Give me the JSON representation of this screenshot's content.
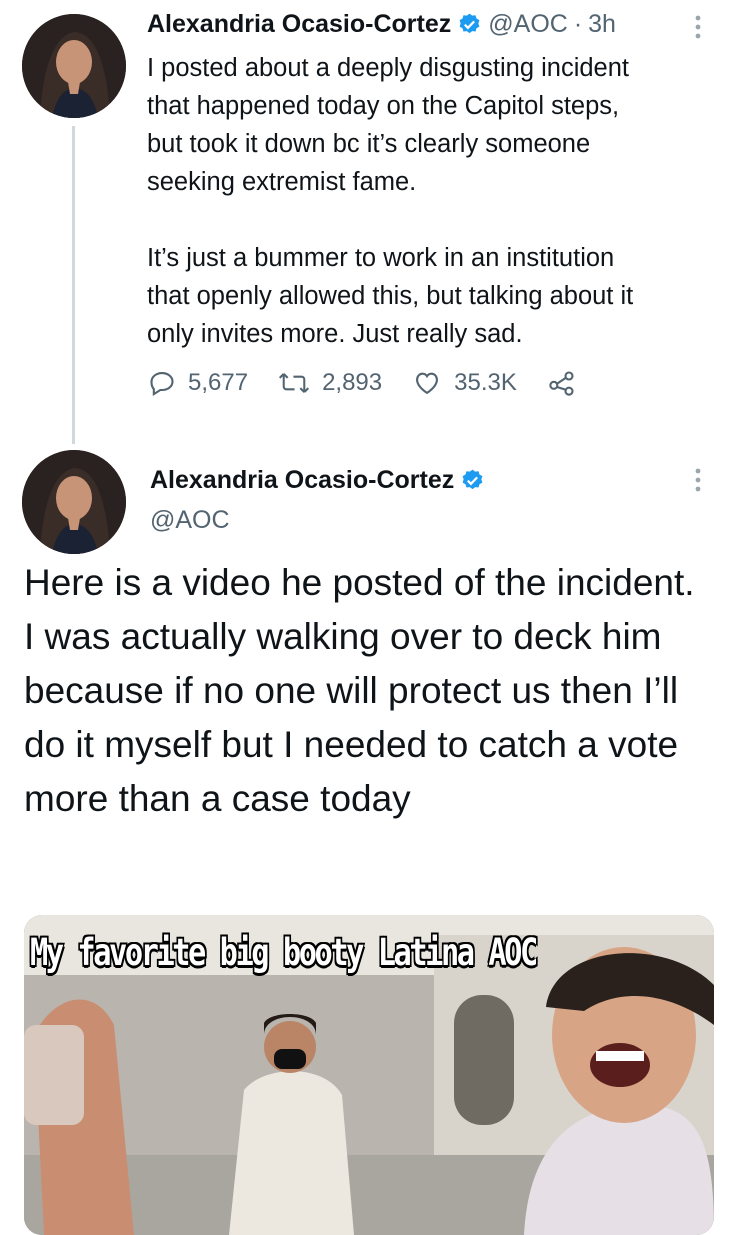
{
  "tweet1": {
    "name": "Alexandria Ocasio-Cortez",
    "handle": "@AOC",
    "sep": "·",
    "time": "3h",
    "text": "I posted about a deeply disgusting incident\nthat happened today on the Capitol steps,\nbut took it down bc it’s clearly someone\nseeking extremist fame.\n\nIt’s just a bummer to work in an institution\nthat openly allowed this, but talking about it\nonly invites more. Just really sad.",
    "replies": "5,677",
    "retweets": "2,893",
    "likes": "35.3K"
  },
  "tweet2": {
    "name": "Alexandria Ocasio-Cortez",
    "handle": "@AOC",
    "text": "Here is a video he posted of the incident. I was actually walking over to deck him because if no one will protect us then I’ll do it myself but I needed to catch a vote more than a case today",
    "video_caption": "My favorite big booty Latina AOC"
  },
  "icons": {
    "verified": "verified-badge-icon",
    "reply": "reply-icon",
    "retweet": "retweet-icon",
    "like": "heart-icon",
    "share": "share-icon",
    "more": "more-vertical-icon"
  },
  "colors": {
    "verified": "#1d9bf0",
    "text": "#0f1419",
    "secondary": "#536471"
  }
}
